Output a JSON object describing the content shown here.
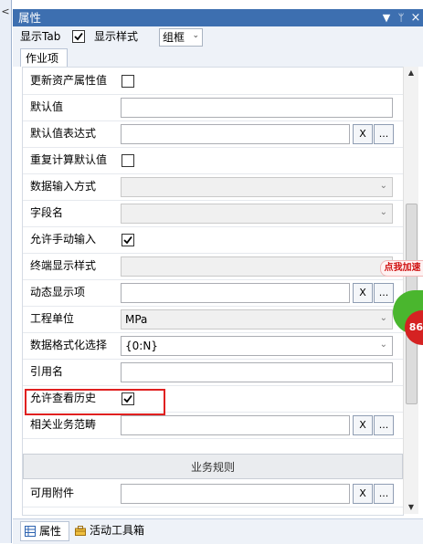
{
  "window": {
    "title": "属性",
    "controls": {
      "dropdown": "▼",
      "pin": "ᛘ",
      "close": "×"
    },
    "left_chevron": "<"
  },
  "toolbar": {
    "show_tab_label": "显示Tab",
    "show_tab_checked": true,
    "display_style_label": "显示样式",
    "display_style_value": "组框"
  },
  "tabs": {
    "active": "作业项"
  },
  "properties": [
    {
      "label": "更新资产属性值",
      "type": "checkbox",
      "checked": false
    },
    {
      "label": "默认值",
      "type": "text",
      "value": ""
    },
    {
      "label": "默认值表达式",
      "type": "text-buttons",
      "value": "",
      "btn1": "X",
      "btn2": "..."
    },
    {
      "label": "重复计算默认值",
      "type": "checkbox",
      "checked": false
    },
    {
      "label": "数据输入方式",
      "type": "select-disabled",
      "value": ""
    },
    {
      "label": "字段名",
      "type": "select-disabled",
      "value": ""
    },
    {
      "label": "允许手动输入",
      "type": "checkbox",
      "checked": true
    },
    {
      "label": "终端显示样式",
      "type": "select-disabled",
      "value": ""
    },
    {
      "label": "动态显示项",
      "type": "text-buttons",
      "value": "",
      "btn1": "X",
      "btn2": "..."
    },
    {
      "label": "工程单位",
      "type": "select-disabled",
      "value": "MPa"
    },
    {
      "label": "数据格式化选择",
      "type": "select",
      "value": "{0:N}"
    },
    {
      "label": "引用名",
      "type": "text",
      "value": ""
    },
    {
      "label": "允许查看历史",
      "type": "checkbox",
      "checked": true,
      "highlighted": true
    },
    {
      "label": "相关业务范畴",
      "type": "text-buttons",
      "value": "",
      "btn1": "X",
      "btn2": "..."
    }
  ],
  "section": {
    "title": "业务规则"
  },
  "section_properties": [
    {
      "label": "可用附件",
      "type": "text-buttons",
      "value": "",
      "btn1": "X",
      "btn2": "..."
    }
  ],
  "overlay_widget": {
    "badge_text": "点我加速",
    "counter_text": "86"
  },
  "bottom_tabs": [
    {
      "label": "属性",
      "icon": "properties-grid-icon",
      "active": true
    },
    {
      "label": "活动工具箱",
      "icon": "toolbox-icon",
      "active": false
    }
  ],
  "colors": {
    "title_bar": "#3d6fb0",
    "highlight_border": "#e02020"
  }
}
